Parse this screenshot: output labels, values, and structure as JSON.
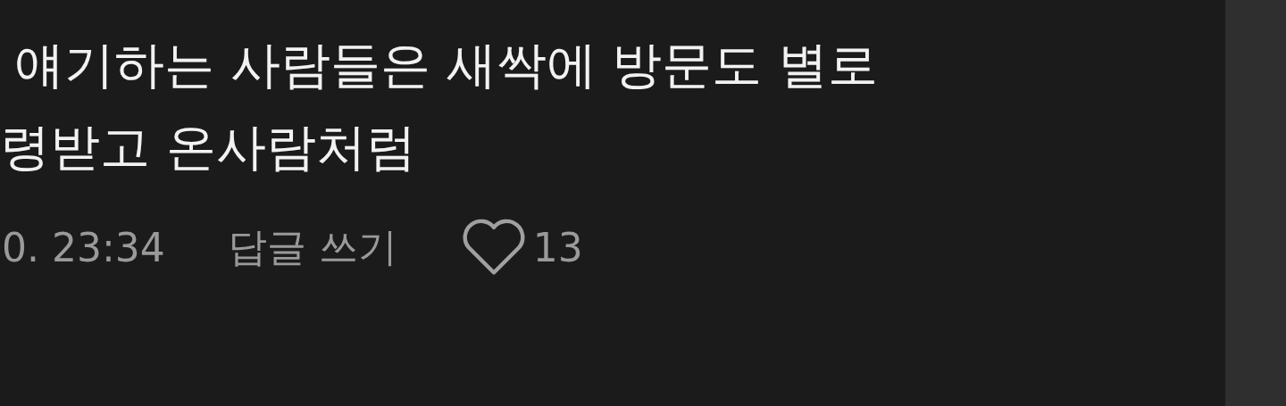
{
  "comment": {
    "lines": [
      "얘기하는 사람들은 새싹에 방문도 별로",
      "령받고 온사람처럼"
    ],
    "time": "0. 23:34",
    "reply": "답글 쓰기",
    "likes": "13",
    "liked": false
  }
}
